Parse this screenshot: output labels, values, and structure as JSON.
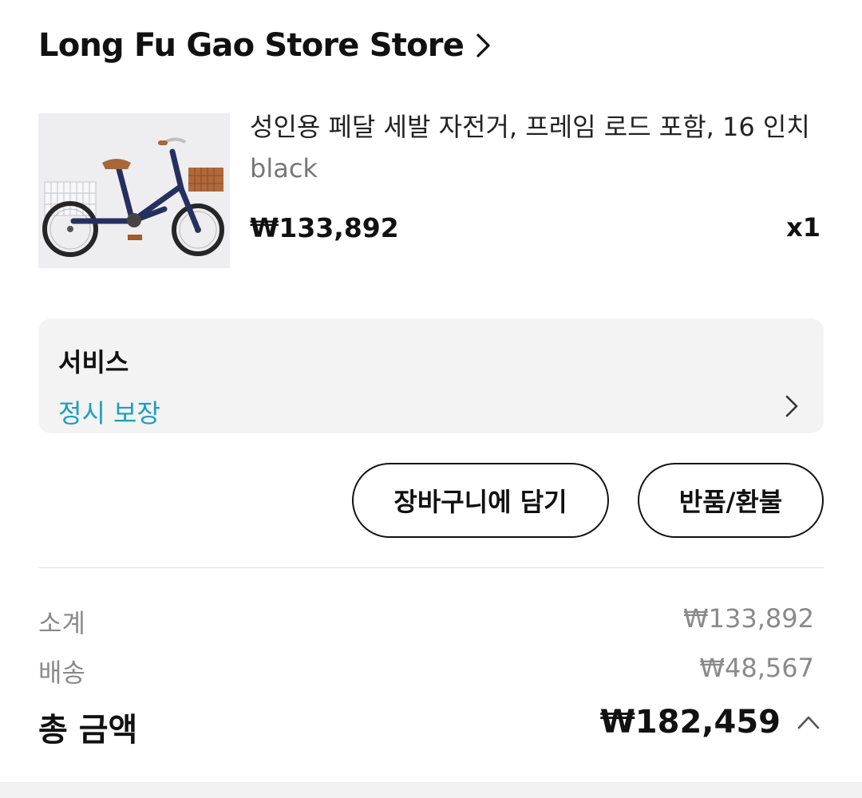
{
  "store": {
    "name": "Long Fu Gao Store Store"
  },
  "product": {
    "title": "성인용 페달 세발 자전거, 프레임 로드 포함, 16 인치",
    "variant": "black",
    "price": "₩133,892",
    "quantity": "x1",
    "image_icon": "tricycle-image"
  },
  "service": {
    "label": "서비스",
    "value": "정시 보장"
  },
  "actions": {
    "add_to_cart": "장바구니에 담기",
    "return_refund": "반품/환불"
  },
  "summary": {
    "subtotal_label": "소계",
    "subtotal_value": "₩133,892",
    "shipping_label": "배송",
    "shipping_value": "₩48,567",
    "total_label": "총 금액",
    "total_value": "₩182,459"
  },
  "colors": {
    "accent_link": "#1a9fbf",
    "primary_text": "#111111",
    "secondary_text": "#8a8a8a",
    "card_background": "#f3f3f3"
  }
}
